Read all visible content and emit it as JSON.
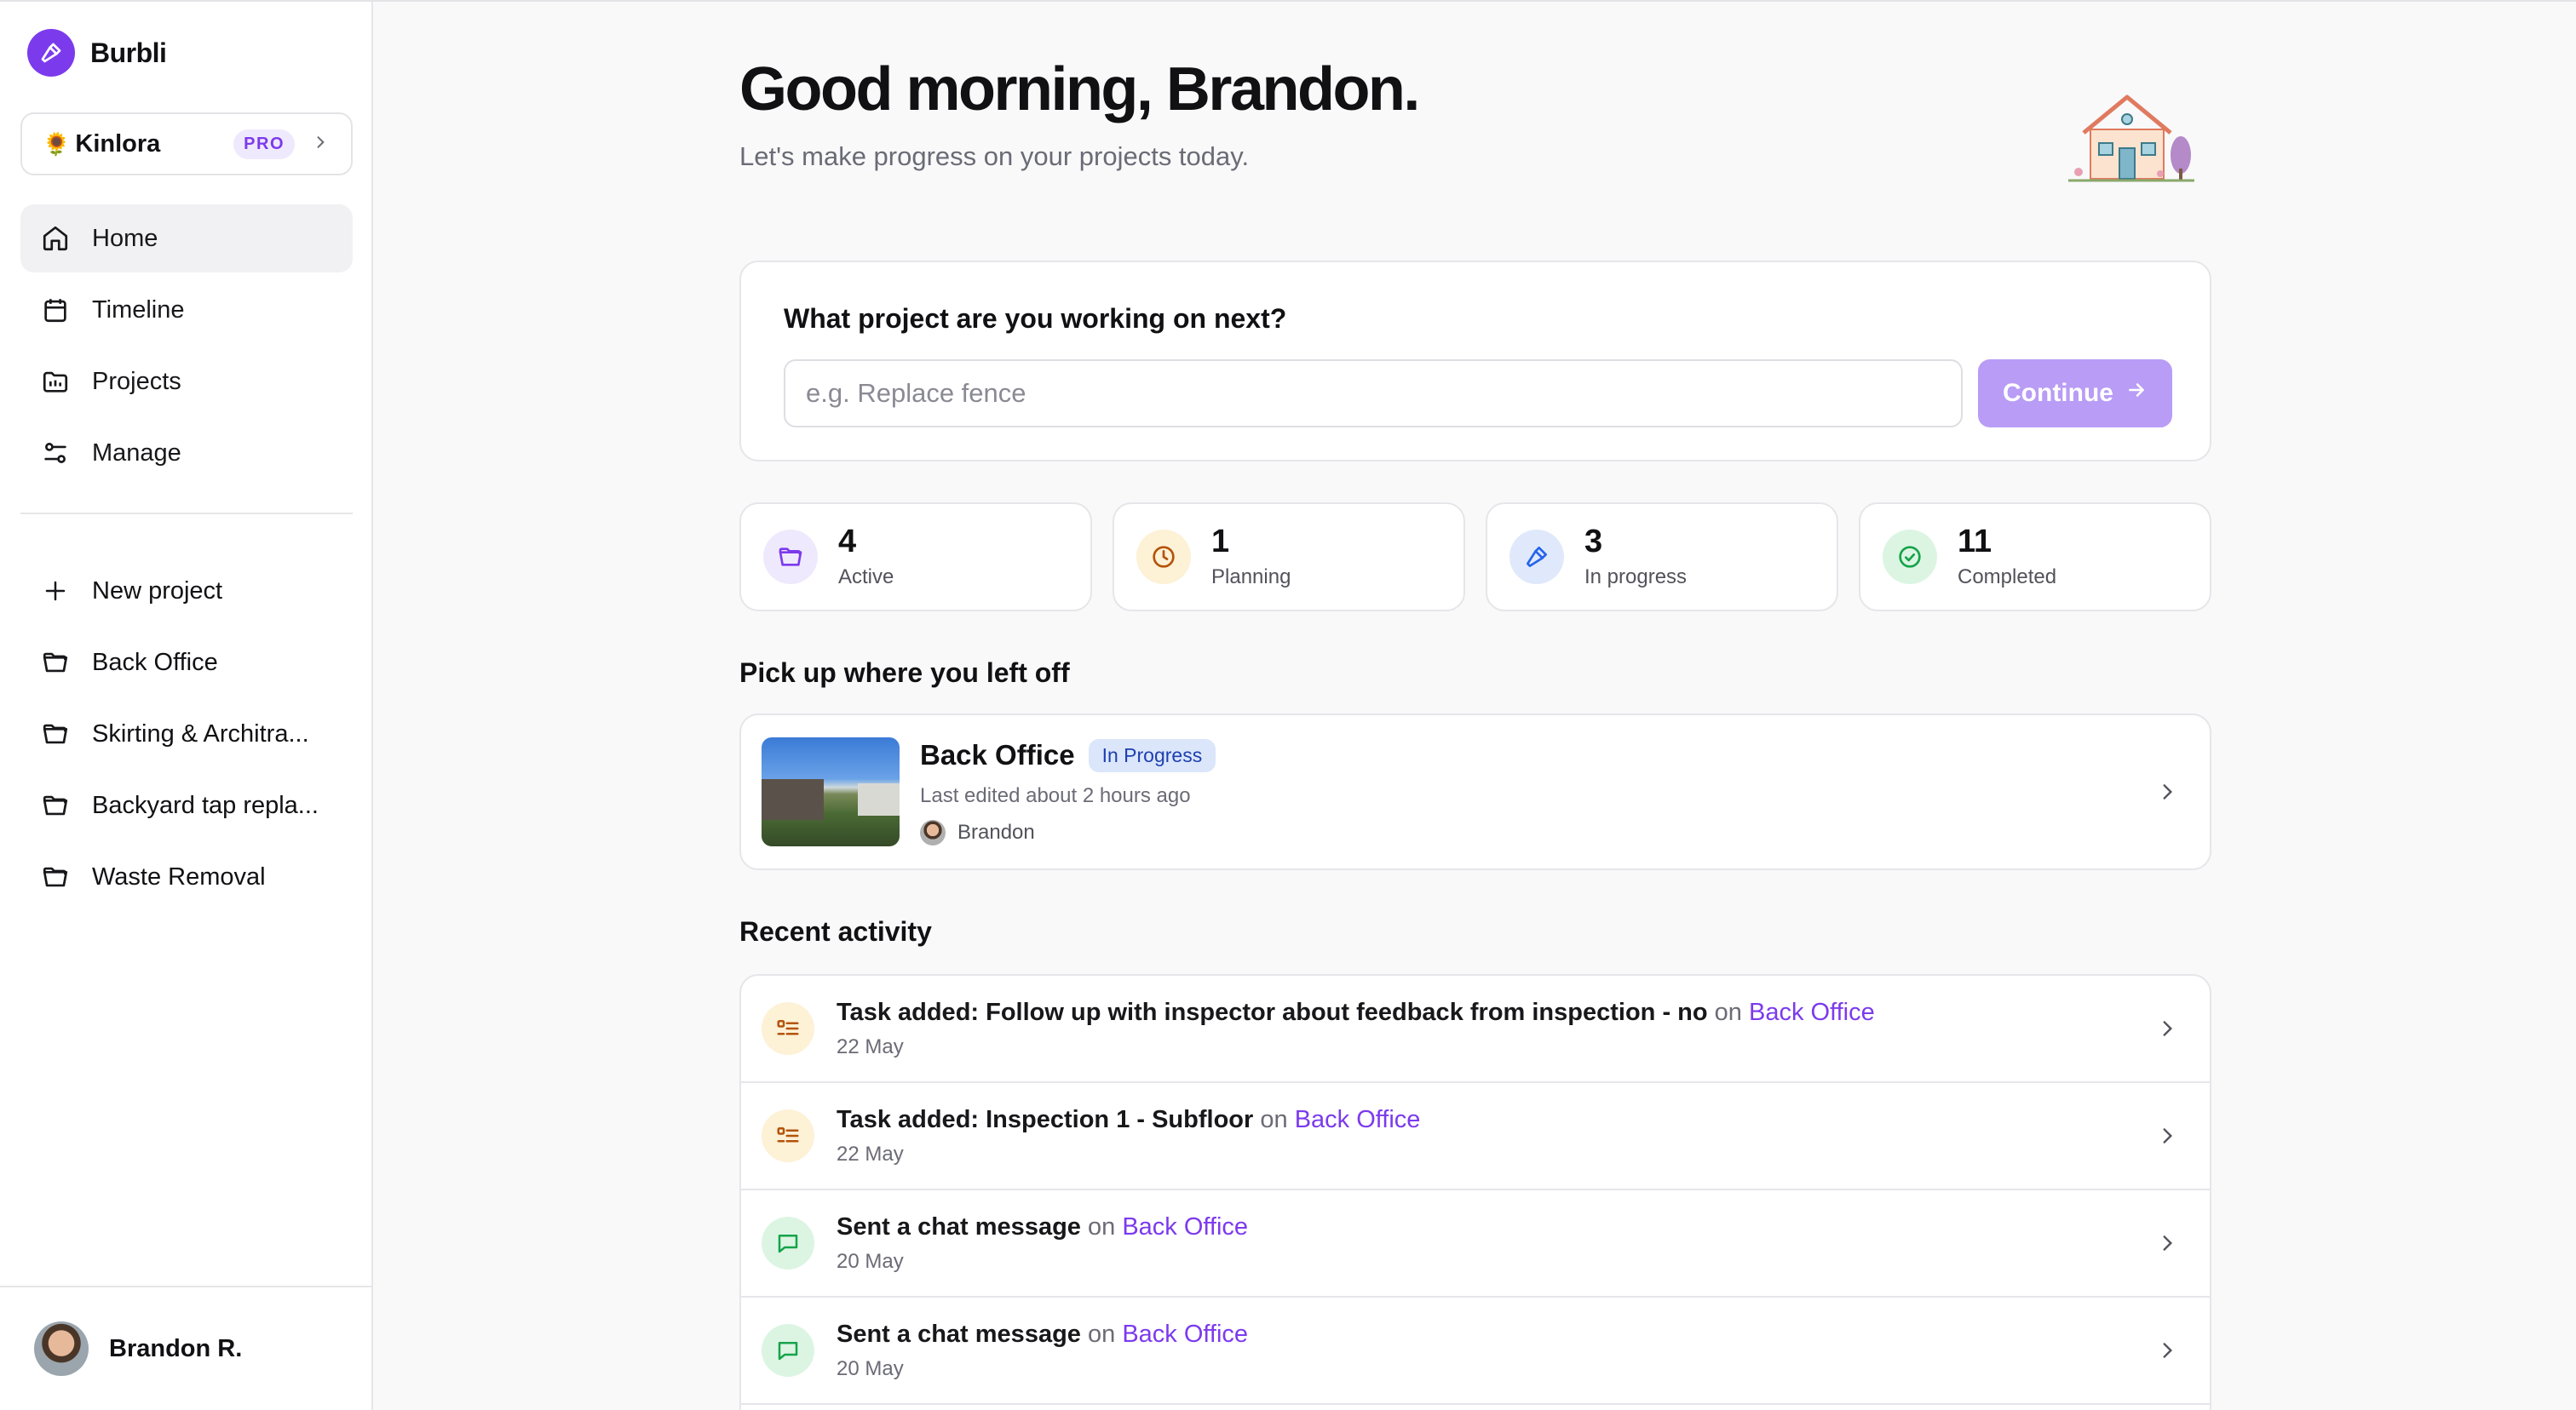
{
  "app": {
    "name": "Burbli"
  },
  "workspace": {
    "emoji": "🌻",
    "name": "Kinlora",
    "badge": "PRO"
  },
  "nav": {
    "items": [
      {
        "label": "Home",
        "icon": "home-icon"
      },
      {
        "label": "Timeline",
        "icon": "calendar-icon"
      },
      {
        "label": "Projects",
        "icon": "projects-icon"
      },
      {
        "label": "Manage",
        "icon": "sliders-icon"
      }
    ]
  },
  "sidebar_projects": {
    "new_label": "New project",
    "items": [
      {
        "label": "Back Office"
      },
      {
        "label": "Skirting & Architra..."
      },
      {
        "label": "Backyard tap repla..."
      },
      {
        "label": "Waste Removal"
      }
    ]
  },
  "user": {
    "name": "Brandon R."
  },
  "header": {
    "greeting": "Good morning, Brandon.",
    "subtitle": "Let's make progress on your projects today."
  },
  "ask": {
    "title": "What project are you working on next?",
    "placeholder": "e.g. Replace fence",
    "value": "",
    "button": "Continue"
  },
  "stats": [
    {
      "value": "4",
      "label": "Active",
      "icon": "folder-icon",
      "color": "#7c3aed"
    },
    {
      "value": "1",
      "label": "Planning",
      "icon": "clock-icon",
      "color": "#b45309"
    },
    {
      "value": "3",
      "label": "In progress",
      "icon": "hammer-icon",
      "color": "#2563eb"
    },
    {
      "value": "11",
      "label": "Completed",
      "icon": "check-circle-icon",
      "color": "#16a34a"
    }
  ],
  "resume": {
    "section_title": "Pick up where you left off",
    "project": "Back Office",
    "status": "In Progress",
    "edited": "Last edited about 2 hours ago",
    "user": "Brandon"
  },
  "activity": {
    "section_title": "Recent activity",
    "items": [
      {
        "text": "Task added: Follow up with inspector about feedback from inspection - no",
        "on": "on",
        "project": "Back Office",
        "date": "22 May",
        "icon": "task-list-icon"
      },
      {
        "text": "Task added: Inspection 1 - Subfloor",
        "on": "on",
        "project": "Back Office",
        "date": "22 May",
        "icon": "task-list-icon"
      },
      {
        "text": "Sent a chat message",
        "on": "on",
        "project": "Back Office",
        "date": "20 May",
        "icon": "chat-icon"
      },
      {
        "text": "Sent a chat message",
        "on": "on",
        "project": "Back Office",
        "date": "20 May",
        "icon": "chat-icon"
      }
    ]
  }
}
